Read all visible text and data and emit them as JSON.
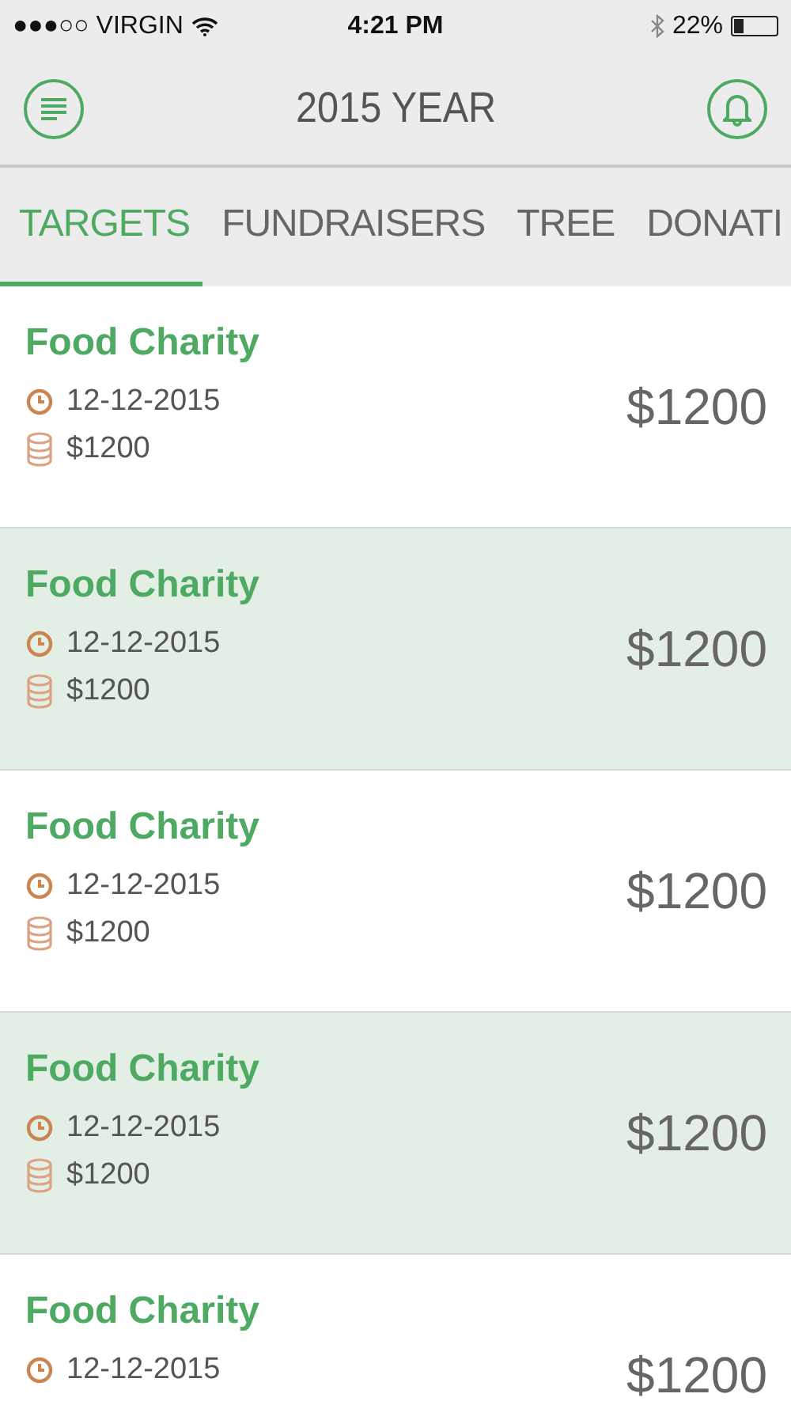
{
  "status_bar": {
    "carrier": "●●●○○ VIRGIN",
    "time": "4:21 PM",
    "battery": "22%"
  },
  "header": {
    "title": "2015 YEAR"
  },
  "tabs": [
    {
      "label": "TARGETS",
      "selected": true
    },
    {
      "label": "FUNDRAISERS",
      "selected": false
    },
    {
      "label": "TREE",
      "selected": false
    },
    {
      "label": "DONATI",
      "selected": false
    }
  ],
  "items": [
    {
      "name": "Food Charity",
      "date": "12-12-2015",
      "raised": "$1200",
      "amount": "$1200",
      "shaded": false
    },
    {
      "name": "Food Charity",
      "date": "12-12-2015",
      "raised": "$1200",
      "amount": "$1200",
      "shaded": true
    },
    {
      "name": "Food Charity",
      "date": "12-12-2015",
      "raised": "$1200",
      "amount": "$1200",
      "shaded": false
    },
    {
      "name": "Food Charity",
      "date": "12-12-2015",
      "raised": "$1200",
      "amount": "$1200",
      "shaded": true
    },
    {
      "name": "Food Charity",
      "date": "12-12-2015",
      "amount": "$1200",
      "shaded": false
    }
  ]
}
